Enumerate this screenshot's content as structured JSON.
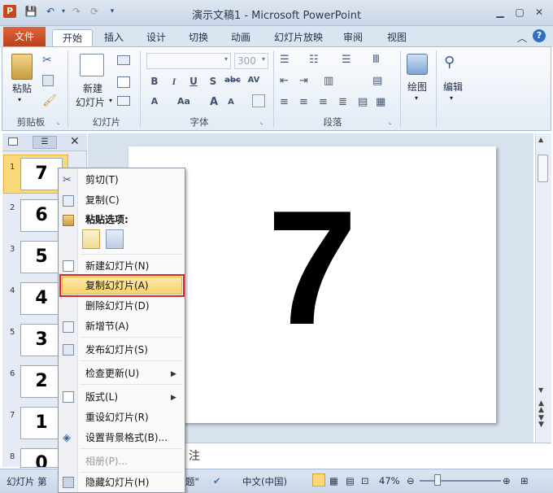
{
  "window": {
    "title": "演示文稿1 - Microsoft PowerPoint",
    "app_icon": "P"
  },
  "quick_access": [
    "save-icon",
    "undo-icon",
    "redo-icon",
    "customize-icon"
  ],
  "tabs": [
    "文件",
    "开始",
    "插入",
    "设计",
    "切换",
    "动画",
    "幻灯片放映",
    "审阅",
    "视图"
  ],
  "active_tab": "开始",
  "ribbon": {
    "paste": "粘贴",
    "new_slide_1": "新建",
    "new_slide_2": "幻灯片",
    "font_size": "300",
    "draw": "绘图",
    "edit": "编辑",
    "groups": [
      "剪贴板",
      "幻灯片",
      "字体",
      "段落"
    ]
  },
  "thumbnails": [
    {
      "num": "1",
      "text": "7"
    },
    {
      "num": "2",
      "text": "6"
    },
    {
      "num": "3",
      "text": "5"
    },
    {
      "num": "4",
      "text": "4"
    },
    {
      "num": "5",
      "text": "3"
    },
    {
      "num": "6",
      "text": "2"
    },
    {
      "num": "7",
      "text": "1"
    },
    {
      "num": "8",
      "text": "0"
    }
  ],
  "slide": {
    "content": "7"
  },
  "notes_fragment": "注",
  "context_menu": {
    "cut": "剪切(T)",
    "copy": "复制(C)",
    "paste_options": "粘贴选项:",
    "new_slide": "新建幻灯片(N)",
    "duplicate_slide": "复制幻灯片(A)",
    "delete_slide": "删除幻灯片(D)",
    "add_section": "新增节(A)",
    "publish_slides": "发布幻灯片(S)",
    "check_updates": "检查更新(U)",
    "layout": "版式(L)",
    "reset_slide": "重设幻灯片(R)",
    "format_background": "设置背景格式(B)...",
    "photo_album": "相册(P)...",
    "hide_slide": "隐藏幻灯片(H)"
  },
  "status": {
    "slide_info": "幻灯片 第",
    "theme_fragment": "题\"",
    "language": "中文(中国)",
    "zoom": "47%"
  },
  "colors": {
    "file_tab": "#c7481b",
    "highlight_border": "#d9242a",
    "selected": "#f9d97a"
  }
}
